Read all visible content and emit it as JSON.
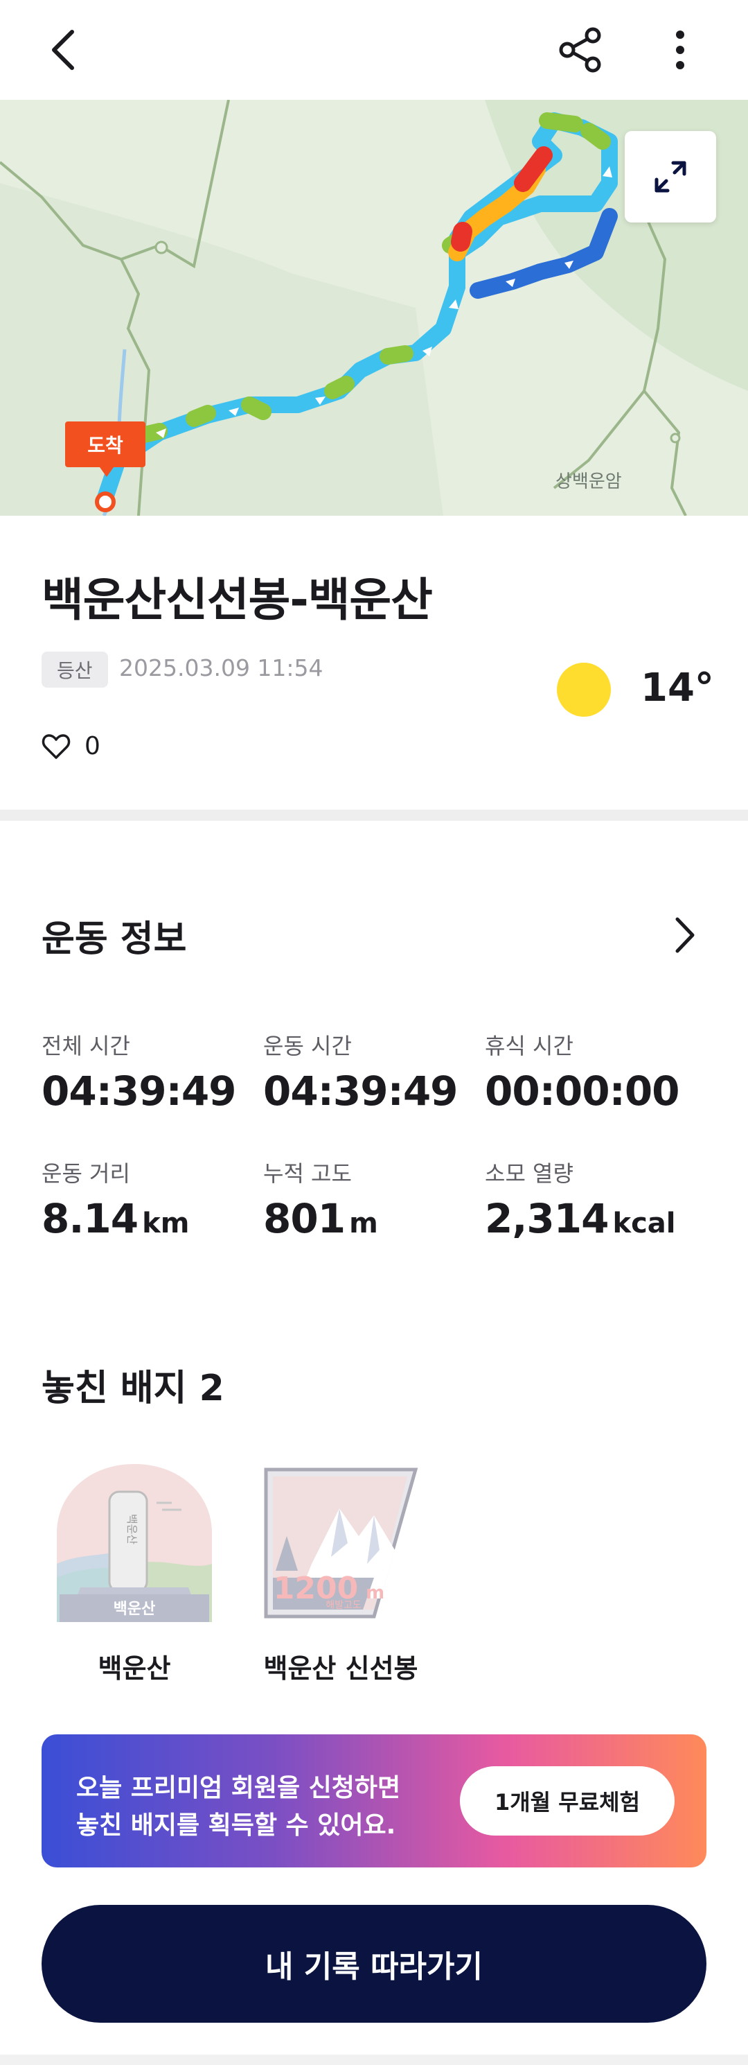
{
  "map": {
    "arrive_label": "도착",
    "place_label": "상백운암",
    "route_colors": [
      "#3fc1ef",
      "#2b6fd6",
      "#8dc63f",
      "#ffb21b",
      "#e8332a"
    ]
  },
  "activity": {
    "title": "백운산신선봉-백운산",
    "tag": "등산",
    "datetime": "2025.03.09 11:54",
    "weather_icon": "sun-icon",
    "temperature": "14°",
    "likes": "0"
  },
  "exercise_info": {
    "heading": "운동 정보",
    "stats": [
      {
        "label": "전체 시간",
        "value": "04:39:49",
        "unit": ""
      },
      {
        "label": "운동 시간",
        "value": "04:39:49",
        "unit": ""
      },
      {
        "label": "휴식 시간",
        "value": "00:00:00",
        "unit": ""
      },
      {
        "label": "운동 거리",
        "value": "8.14",
        "unit": "km"
      },
      {
        "label": "누적 고도",
        "value": "801",
        "unit": "m"
      },
      {
        "label": "소모 열량",
        "value": "2,314",
        "unit": "kcal"
      }
    ]
  },
  "badges": {
    "heading": "놓친 배지 2",
    "items": [
      {
        "name": "백운산",
        "ribbon": "백운산",
        "stone_text": "백운산"
      },
      {
        "name": "백운산 신선봉",
        "altitude": "1200",
        "altitude_unit": "m",
        "altitude_caption": "해발고도"
      }
    ]
  },
  "promo": {
    "line1": "오늘 프리미엄 회원을 신청하면",
    "line2": "놓친 배지를 획득할 수 있어요.",
    "button": "1개월 무료체험"
  },
  "follow_button": "내 기록 따라가기"
}
